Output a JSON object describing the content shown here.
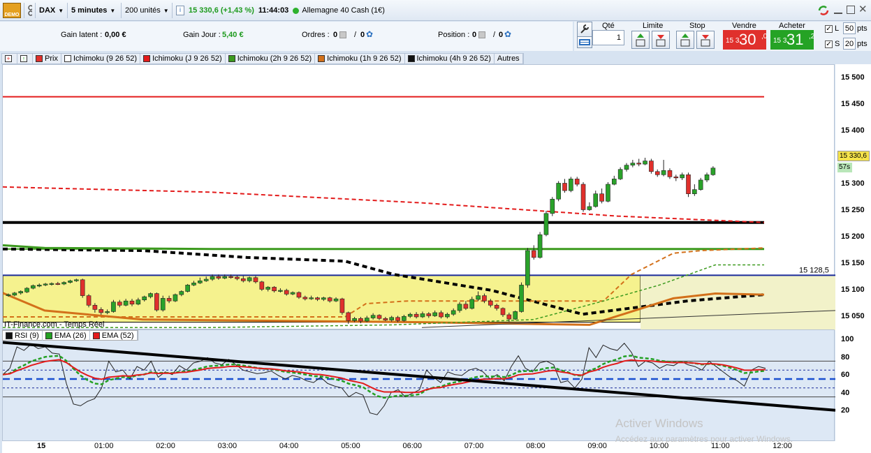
{
  "toolbar": {
    "demo_label": "DEMO",
    "instrument": "DAX",
    "timeframe": "5 minutes",
    "quantity": "200 unités",
    "quote": "15 330,6 (+1,43 %)",
    "time": "11:44:03",
    "market_name": "Allemagne 40 Cash (1€)"
  },
  "info": {
    "gain_latent_label": "Gain latent :",
    "gain_latent_value": "0,00 €",
    "gain_jour_label": "Gain Jour :",
    "gain_jour_value": "5,40 €",
    "ordres_label": "Ordres :",
    "ordres_a": "0",
    "ordres_b": "0",
    "position_label": "Position :",
    "position_a": "0",
    "position_b": "0",
    "slash": "/"
  },
  "trade": {
    "qte_label": "Qté",
    "qte_value": "1",
    "limite_label": "Limite",
    "stop_label": "Stop",
    "vendre_label": "Vendre",
    "acheter_label": "Acheter",
    "sell_prefix": "15 3",
    "sell_big": "30",
    "sell_small": ",0",
    "buy_prefix": "15 3",
    "buy_big": "31",
    "buy_small": ",2",
    "l_label": "L",
    "l_value": "50",
    "s_label": "S",
    "s_value": "20",
    "pts": "pts",
    "check": "✓"
  },
  "legend": [
    {
      "label": "Prix",
      "color": "#e0302c"
    },
    {
      "label": "Ichimoku (9 26 52)",
      "color": "#ffffff"
    },
    {
      "label": "Ichimoku (J 9 26 52)",
      "color": "#e31b1b"
    },
    {
      "label": "Ichimoku (2h 9 26 52)",
      "color": "#3c9a1e"
    },
    {
      "label": "Ichimoku (1h 9 26 52)",
      "color": "#d3701a"
    },
    {
      "label": "Ichimoku (4h 9 26 52)",
      "color": "#111111"
    }
  ],
  "legend_other": "Autres",
  "source_label": "IT-Finance.com - Temps Réel",
  "price_axis": [
    "15 500",
    "15 450",
    "15 400",
    "15 350",
    "15 300",
    "15 250",
    "15 200",
    "15 150",
    "15 100",
    "15 050"
  ],
  "current_price_tag": "15 330,6",
  "countdown_tag": "57s",
  "level_label": "15 128,5",
  "rsi_legend": [
    {
      "label": "RSI (9)",
      "color": "#111111"
    },
    {
      "label": "EMA (26)",
      "color": "#23a023"
    },
    {
      "label": "EMA (52)",
      "color": "#e31b1b"
    }
  ],
  "rsi_axis": [
    "100",
    "80",
    "60",
    "40",
    "20"
  ],
  "time_axis": [
    "15",
    "01:00",
    "02:00",
    "03:00",
    "04:00",
    "05:00",
    "06:00",
    "07:00",
    "08:00",
    "09:00",
    "10:00",
    "11:00",
    "12:00"
  ],
  "watermark": {
    "title": "Activer Windows",
    "subtitle": "Accédez aux paramètres pour activer Windows."
  },
  "chart_data": {
    "type": "candlestick",
    "series": [
      {
        "open": 15090,
        "close": 15092,
        "high": 15094,
        "low": 15088
      },
      {
        "open": 15091,
        "close": 15095,
        "high": 15097,
        "low": 15089
      },
      {
        "open": 15095,
        "close": 15098,
        "high": 15100,
        "low": 15092
      },
      {
        "open": 15097,
        "close": 15104,
        "high": 15106,
        "low": 15095
      },
      {
        "open": 15104,
        "close": 15109,
        "high": 15111,
        "low": 15102
      },
      {
        "open": 15108,
        "close": 15110,
        "high": 15113,
        "low": 15106
      },
      {
        "open": 15110,
        "close": 15112,
        "high": 15114,
        "low": 15108
      },
      {
        "open": 15111,
        "close": 15113,
        "high": 15115,
        "low": 15109
      },
      {
        "open": 15113,
        "close": 15112,
        "high": 15116,
        "low": 15110
      },
      {
        "open": 15112,
        "close": 15115,
        "high": 15117,
        "low": 15110
      },
      {
        "open": 15115,
        "close": 15118,
        "high": 15120,
        "low": 15113
      },
      {
        "open": 15118,
        "close": 15120,
        "high": 15122,
        "low": 15116
      },
      {
        "open": 15120,
        "close": 15090,
        "high": 15122,
        "low": 15086
      },
      {
        "open": 15090,
        "close": 15072,
        "high": 15093,
        "low": 15068
      },
      {
        "open": 15072,
        "close": 15064,
        "high": 15076,
        "low": 15058
      },
      {
        "open": 15064,
        "close": 15058,
        "high": 15068,
        "low": 15054
      },
      {
        "open": 15058,
        "close": 15060,
        "high": 15064,
        "low": 15055
      },
      {
        "open": 15060,
        "close": 15078,
        "high": 15082,
        "low": 15058
      },
      {
        "open": 15078,
        "close": 15072,
        "high": 15082,
        "low": 15068
      },
      {
        "open": 15072,
        "close": 15080,
        "high": 15084,
        "low": 15070
      },
      {
        "open": 15080,
        "close": 15074,
        "high": 15084,
        "low": 15070
      },
      {
        "open": 15074,
        "close": 15082,
        "high": 15086,
        "low": 15072
      },
      {
        "open": 15082,
        "close": 15088,
        "high": 15090,
        "low": 15079
      },
      {
        "open": 15088,
        "close": 15094,
        "high": 15096,
        "low": 15085
      },
      {
        "open": 15094,
        "close": 15063,
        "high": 15096,
        "low": 15060
      },
      {
        "open": 15063,
        "close": 15085,
        "high": 15090,
        "low": 15060
      },
      {
        "open": 15085,
        "close": 15080,
        "high": 15090,
        "low": 15076
      },
      {
        "open": 15080,
        "close": 15092,
        "high": 15094,
        "low": 15078
      },
      {
        "open": 15092,
        "close": 15098,
        "high": 15100,
        "low": 15089
      },
      {
        "open": 15098,
        "close": 15110,
        "high": 15112,
        "low": 15096
      },
      {
        "open": 15110,
        "close": 15114,
        "high": 15118,
        "low": 15108
      },
      {
        "open": 15114,
        "close": 15118,
        "high": 15124,
        "low": 15112
      },
      {
        "open": 15118,
        "close": 15121,
        "high": 15126,
        "low": 15116
      },
      {
        "open": 15121,
        "close": 15126,
        "high": 15130,
        "low": 15118
      },
      {
        "open": 15126,
        "close": 15123,
        "high": 15130,
        "low": 15120
      },
      {
        "open": 15123,
        "close": 15126,
        "high": 15130,
        "low": 15121
      },
      {
        "open": 15126,
        "close": 15125,
        "high": 15130,
        "low": 15122
      },
      {
        "open": 15125,
        "close": 15122,
        "high": 15128,
        "low": 15119
      },
      {
        "open": 15122,
        "close": 15118,
        "high": 15127,
        "low": 15115
      },
      {
        "open": 15118,
        "close": 15124,
        "high": 15126,
        "low": 15115
      },
      {
        "open": 15124,
        "close": 15116,
        "high": 15127,
        "low": 15113
      },
      {
        "open": 15116,
        "close": 15102,
        "high": 15118,
        "low": 15099
      },
      {
        "open": 15102,
        "close": 15106,
        "high": 15108,
        "low": 15098
      },
      {
        "open": 15106,
        "close": 15099,
        "high": 15108,
        "low": 15096
      },
      {
        "open": 15099,
        "close": 15100,
        "high": 15104,
        "low": 15096
      },
      {
        "open": 15100,
        "close": 15093,
        "high": 15103,
        "low": 15090
      },
      {
        "open": 15093,
        "close": 15096,
        "high": 15098,
        "low": 15091
      },
      {
        "open": 15096,
        "close": 15087,
        "high": 15098,
        "low": 15084
      },
      {
        "open": 15087,
        "close": 15084,
        "high": 15090,
        "low": 15081
      },
      {
        "open": 15084,
        "close": 15086,
        "high": 15090,
        "low": 15082
      },
      {
        "open": 15086,
        "close": 15083,
        "high": 15088,
        "low": 15080
      },
      {
        "open": 15083,
        "close": 15086,
        "high": 15088,
        "low": 15080
      },
      {
        "open": 15086,
        "close": 15080,
        "high": 15088,
        "low": 15077
      },
      {
        "open": 15080,
        "close": 15084,
        "high": 15087,
        "low": 15078
      },
      {
        "open": 15084,
        "close": 15058,
        "high": 15086,
        "low": 15054
      },
      {
        "open": 15058,
        "close": 15043,
        "high": 15060,
        "low": 15037
      },
      {
        "open": 15043,
        "close": 15047,
        "high": 15050,
        "low": 15040
      },
      {
        "open": 15047,
        "close": 15042,
        "high": 15050,
        "low": 15038
      },
      {
        "open": 15042,
        "close": 15048,
        "high": 15052,
        "low": 15040
      },
      {
        "open": 15048,
        "close": 15053,
        "high": 15057,
        "low": 15045
      },
      {
        "open": 15053,
        "close": 15047,
        "high": 15055,
        "low": 15044
      },
      {
        "open": 15047,
        "close": 15044,
        "high": 15050,
        "low": 15042
      },
      {
        "open": 15044,
        "close": 15049,
        "high": 15052,
        "low": 15041
      },
      {
        "open": 15049,
        "close": 15043,
        "high": 15052,
        "low": 15040
      },
      {
        "open": 15043,
        "close": 15051,
        "high": 15054,
        "low": 15041
      },
      {
        "open": 15051,
        "close": 15055,
        "high": 15058,
        "low": 15048
      },
      {
        "open": 15055,
        "close": 15050,
        "high": 15059,
        "low": 15047
      },
      {
        "open": 15050,
        "close": 15056,
        "high": 15060,
        "low": 15048
      },
      {
        "open": 15056,
        "close": 15052,
        "high": 15059,
        "low": 15048
      },
      {
        "open": 15052,
        "close": 15058,
        "high": 15062,
        "low": 15050
      },
      {
        "open": 15058,
        "close": 15050,
        "high": 15062,
        "low": 15047
      },
      {
        "open": 15050,
        "close": 15055,
        "high": 15058,
        "low": 15047
      },
      {
        "open": 15055,
        "close": 15062,
        "high": 15066,
        "low": 15052
      },
      {
        "open": 15062,
        "close": 15074,
        "high": 15078,
        "low": 15058
      },
      {
        "open": 15074,
        "close": 15066,
        "high": 15080,
        "low": 15063
      },
      {
        "open": 15066,
        "close": 15083,
        "high": 15088,
        "low": 15064
      },
      {
        "open": 15083,
        "close": 15090,
        "high": 15098,
        "low": 15080
      },
      {
        "open": 15090,
        "close": 15080,
        "high": 15094,
        "low": 15076
      },
      {
        "open": 15080,
        "close": 15072,
        "high": 15084,
        "low": 15068
      },
      {
        "open": 15072,
        "close": 15066,
        "high": 15075,
        "low": 15062
      },
      {
        "open": 15066,
        "close": 15054,
        "high": 15068,
        "low": 15050
      },
      {
        "open": 15054,
        "close": 15046,
        "high": 15058,
        "low": 15041
      },
      {
        "open": 15046,
        "close": 15060,
        "high": 15062,
        "low": 15044
      },
      {
        "open": 15060,
        "close": 15110,
        "high": 15115,
        "low": 15058
      },
      {
        "open": 15110,
        "close": 15175,
        "high": 15180,
        "low": 15105
      },
      {
        "open": 15175,
        "close": 15162,
        "high": 15185,
        "low": 15158
      },
      {
        "open": 15162,
        "close": 15205,
        "high": 15210,
        "low": 15160
      },
      {
        "open": 15205,
        "close": 15245,
        "high": 15250,
        "low": 15202
      },
      {
        "open": 15245,
        "close": 15272,
        "high": 15276,
        "low": 15240
      },
      {
        "open": 15272,
        "close": 15302,
        "high": 15306,
        "low": 15268
      },
      {
        "open": 15302,
        "close": 15288,
        "high": 15310,
        "low": 15284
      },
      {
        "open": 15288,
        "close": 15310,
        "high": 15314,
        "low": 15285
      },
      {
        "open": 15310,
        "close": 15300,
        "high": 15314,
        "low": 15296
      },
      {
        "open": 15300,
        "close": 15252,
        "high": 15304,
        "low": 15248
      },
      {
        "open": 15252,
        "close": 15258,
        "high": 15266,
        "low": 15250
      },
      {
        "open": 15258,
        "close": 15282,
        "high": 15288,
        "low": 15256
      },
      {
        "open": 15282,
        "close": 15268,
        "high": 15292,
        "low": 15264
      },
      {
        "open": 15268,
        "close": 15300,
        "high": 15304,
        "low": 15266
      },
      {
        "open": 15300,
        "close": 15310,
        "high": 15316,
        "low": 15298
      },
      {
        "open": 15310,
        "close": 15328,
        "high": 15332,
        "low": 15308
      },
      {
        "open": 15328,
        "close": 15336,
        "high": 15340,
        "low": 15324
      },
      {
        "open": 15336,
        "close": 15340,
        "high": 15346,
        "low": 15332
      },
      {
        "open": 15340,
        "close": 15338,
        "high": 15348,
        "low": 15334
      },
      {
        "open": 15338,
        "close": 15344,
        "high": 15350,
        "low": 15336
      },
      {
        "open": 15344,
        "close": 15324,
        "high": 15348,
        "low": 15320
      },
      {
        "open": 15324,
        "close": 15318,
        "high": 15328,
        "low": 15314
      },
      {
        "open": 15318,
        "close": 15326,
        "high": 15346,
        "low": 15315
      },
      {
        "open": 15326,
        "close": 15314,
        "high": 15330,
        "low": 15310
      },
      {
        "open": 15314,
        "close": 15312,
        "high": 15318,
        "low": 15306
      },
      {
        "open": 15312,
        "close": 15318,
        "high": 15322,
        "low": 15308
      },
      {
        "open": 15318,
        "close": 15282,
        "high": 15322,
        "low": 15276
      },
      {
        "open": 15282,
        "close": 15290,
        "high": 15300,
        "low": 15278
      },
      {
        "open": 15290,
        "close": 15308,
        "high": 15312,
        "low": 15288
      },
      {
        "open": 15308,
        "close": 15318,
        "high": 15322,
        "low": 15304
      },
      {
        "open": 15318,
        "close": 15330.6,
        "high": 15334,
        "low": 15316
      }
    ],
    "horizontal_levels": [
      {
        "value": 15465,
        "color": "#e31b1b"
      },
      {
        "value": 15228,
        "color": "#000000"
      },
      {
        "value": 15178,
        "color": "#3c9a1e"
      },
      {
        "value": 15128.5,
        "color": "#1a2a9a"
      }
    ],
    "ylim": [
      15025,
      15525
    ],
    "rsi_series": [
      55,
      62,
      86,
      82,
      89,
      84,
      86,
      79,
      78,
      45,
      22,
      20,
      25,
      28,
      40,
      70,
      58,
      60,
      50,
      64,
      60,
      70,
      52,
      58,
      55,
      65,
      60,
      68,
      70,
      74,
      68,
      66,
      72,
      66,
      60,
      58,
      56,
      57,
      59,
      54,
      50,
      54,
      52,
      48,
      46,
      52,
      45,
      42,
      40,
      30,
      35,
      32,
      12,
      10,
      20,
      35,
      38,
      30,
      34,
      38,
      60,
      52,
      46,
      58,
      55,
      54,
      60,
      62,
      58,
      50,
      55,
      48,
      64,
      76,
      62,
      58,
      68,
      70,
      66,
      46,
      48,
      40,
      50,
      85,
      74,
      88,
      84,
      82,
      90,
      80,
      64,
      70,
      68,
      62,
      66,
      65,
      70,
      66,
      64,
      60,
      70,
      64,
      58,
      52,
      48,
      42,
      60,
      64,
      62
    ],
    "rsi_ylim": [
      0,
      100
    ]
  }
}
